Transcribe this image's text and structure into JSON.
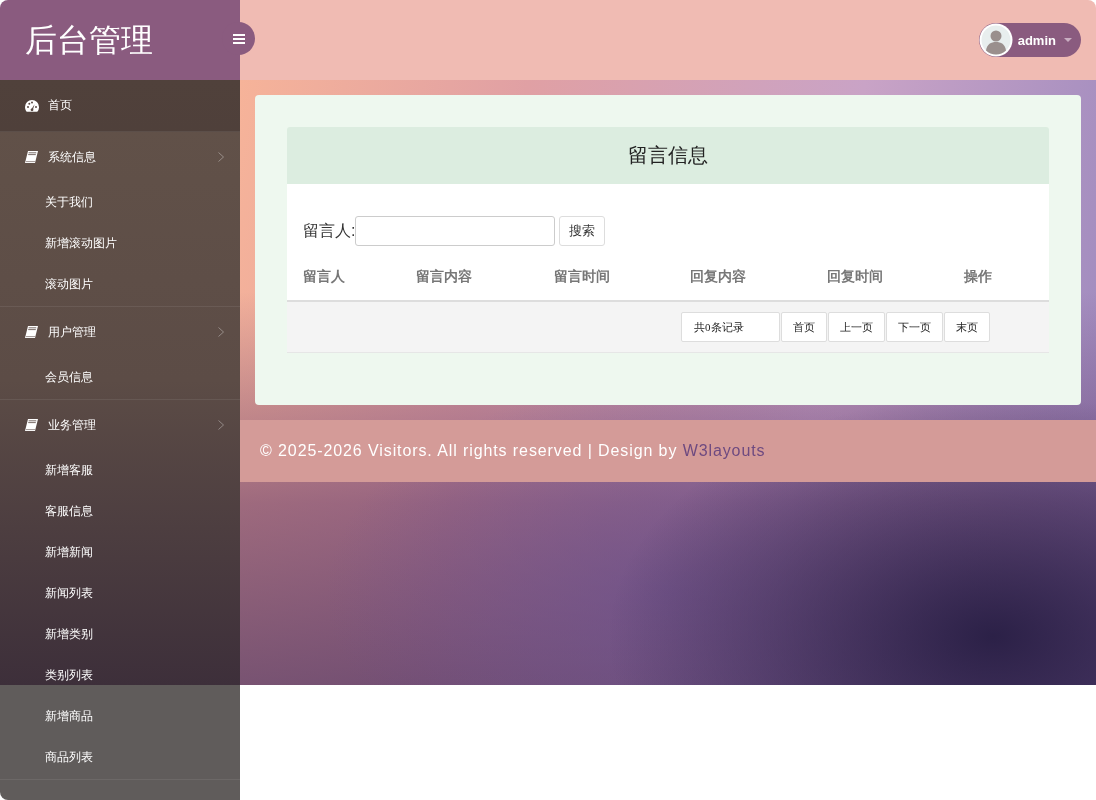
{
  "sidebar": {
    "title": "后台管理",
    "nav": [
      {
        "kind": "link",
        "label": "首页",
        "selected": true
      },
      {
        "kind": "group",
        "label": "系统信息",
        "selected": false,
        "expanded": true,
        "children": [
          {
            "label": "关于我们",
            "selected": false
          },
          {
            "label": "新增滚动图片",
            "selected": false
          },
          {
            "label": "滚动图片",
            "selected": false
          }
        ]
      },
      {
        "kind": "group",
        "label": "用户管理",
        "selected": false,
        "expanded": true,
        "children": [
          {
            "label": "会员信息",
            "selected": false
          }
        ]
      },
      {
        "kind": "group",
        "label": "业务管理",
        "selected": false,
        "expanded": true,
        "children": [
          {
            "label": "新增客服",
            "selected": false
          },
          {
            "label": "客服信息",
            "selected": false
          },
          {
            "label": "新增新闻",
            "selected": false
          },
          {
            "label": "新闻列表",
            "selected": false
          },
          {
            "label": "新增类别",
            "selected": false
          },
          {
            "label": "类别列表",
            "selected": false
          },
          {
            "label": "新增商品",
            "selected": false
          },
          {
            "label": "商品列表",
            "selected": false
          }
        ]
      }
    ]
  },
  "header": {
    "user": {
      "name": "admin"
    }
  },
  "panel": {
    "title": "留言信息",
    "search": {
      "label": "留言人:",
      "button": "搜索"
    },
    "table": {
      "columns": [
        "留言人",
        "留言内容",
        "留言时间",
        "回复内容",
        "回复时间",
        "操作"
      ]
    },
    "pagination": {
      "summary": "共0条记录",
      "buttons": [
        "首页",
        "上一页",
        "下一页",
        "末页"
      ]
    }
  },
  "footer": {
    "text": "© 2025-2026 Visitors. All rights reserved | Design by",
    "link": "W3layouts"
  }
}
